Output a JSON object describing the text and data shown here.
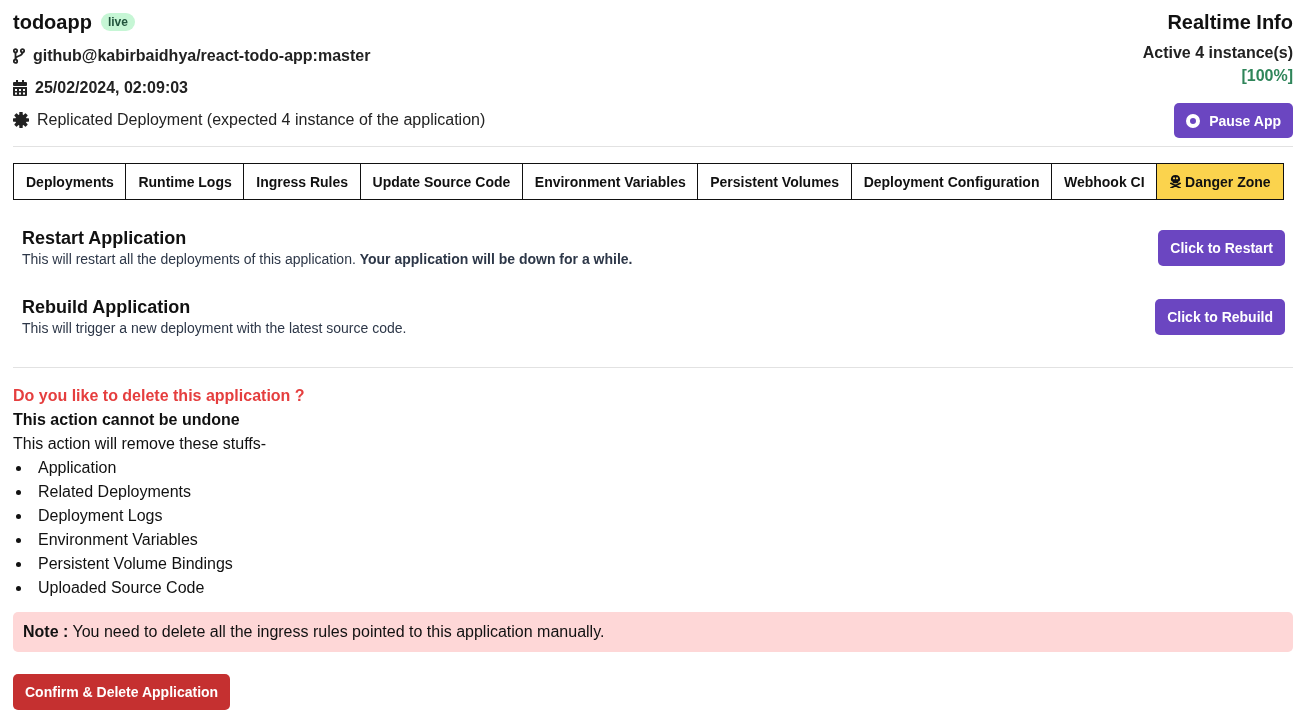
{
  "app": {
    "name": "todoapp",
    "status_badge": "live",
    "source": "github@kabirbaidhya/react-todo-app:master",
    "created_at": "25/02/2024, 02:09:03",
    "deployment_mode": "Replicated Deployment (expected 4 instance of the application)"
  },
  "realtime_info": {
    "title": "Realtime Info",
    "active_instances": "Active 4 instance(s)",
    "health": "[100%]",
    "pause_button": "Pause App"
  },
  "tabs": [
    {
      "label": "Deployments",
      "kind": "plain",
      "selected": false
    },
    {
      "label": "Runtime Logs",
      "kind": "plain",
      "selected": false
    },
    {
      "label": "Ingress Rules",
      "kind": "plain",
      "selected": false
    },
    {
      "label": "Update Source Code",
      "kind": "plain",
      "selected": false
    },
    {
      "label": "Environment Variables",
      "kind": "plain",
      "selected": false
    },
    {
      "label": "Persistent Volumes",
      "kind": "plain",
      "selected": false
    },
    {
      "label": "Deployment Configuration",
      "kind": "plain",
      "selected": false
    },
    {
      "label": "Webhook CI",
      "kind": "plain",
      "selected": false
    },
    {
      "label": "Danger Zone",
      "kind": "danger",
      "selected": true
    }
  ],
  "actions": [
    {
      "title": "Restart Application",
      "description": "This will restart all the deployments of this application. **Your application will be down for a while.**",
      "button": "Click to Restart"
    },
    {
      "title": "Rebuild Application",
      "description": "This will trigger a new deployment with the latest source code.",
      "button": "Click to Rebuild"
    }
  ],
  "delete_section": {
    "question": "Do you like to delete this application ?",
    "warning": "This action cannot be undone",
    "intro": "This action will remove these stuffs-",
    "items": [
      "Application",
      "Related Deployments",
      "Deployment Logs",
      "Environment Variables",
      "Persistent Volume Bindings",
      "Uploaded Source Code"
    ],
    "note": "**Note :** You need to delete all the ingress rules pointed to this application manually.",
    "confirm_button": "Confirm & Delete Application"
  }
}
